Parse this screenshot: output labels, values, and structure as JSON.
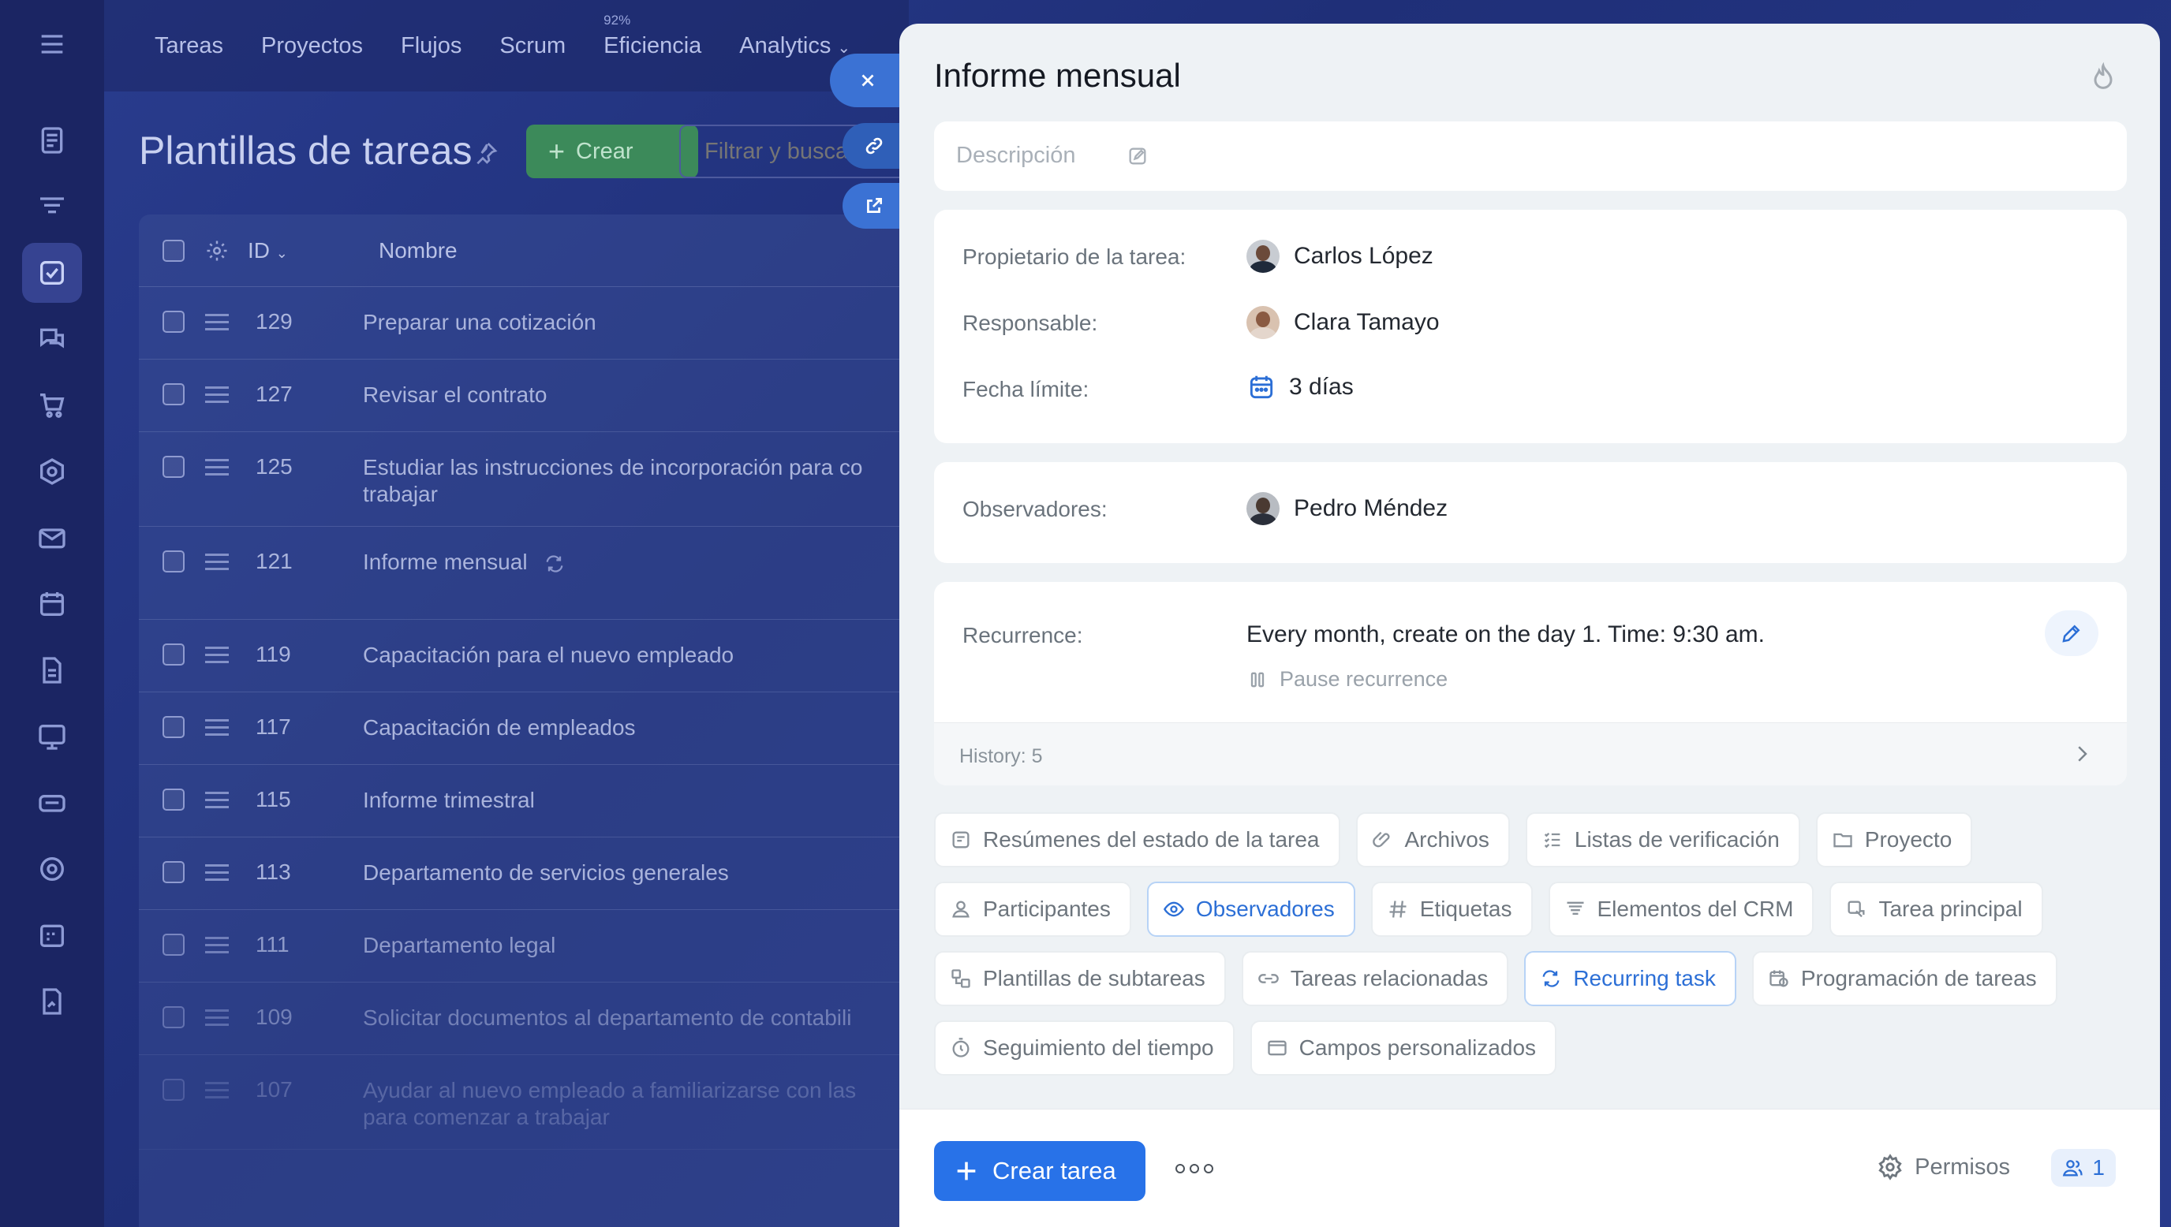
{
  "topnav": {
    "items": [
      "Tareas",
      "Proyectos",
      "Flujos",
      "Scrum",
      "Eficiencia",
      "Analytics"
    ],
    "efficiency_badge": "92%"
  },
  "page": {
    "title": "Plantillas de tareas",
    "create_label": "Crear",
    "filter_placeholder": "Filtrar y buscar"
  },
  "table": {
    "headers": {
      "id": "ID",
      "name": "Nombre"
    },
    "rows": [
      {
        "id": "129",
        "name": "Preparar una cotización"
      },
      {
        "id": "127",
        "name": "Revisar el contrato"
      },
      {
        "id": "125",
        "name": "Estudiar las instrucciones de incorporación para co",
        "name2": "trabajar"
      },
      {
        "id": "121",
        "name": "Informe mensual"
      },
      {
        "id": "119",
        "name": "Capacitación para el nuevo empleado"
      },
      {
        "id": "117",
        "name": "Capacitación de empleados"
      },
      {
        "id": "115",
        "name": "Informe trimestral"
      },
      {
        "id": "113",
        "name": "Departamento de servicios generales"
      },
      {
        "id": "111",
        "name": "Departamento legal"
      },
      {
        "id": "109",
        "name": "Solicitar documentos al departamento de contabili"
      },
      {
        "id": "107",
        "name": "Ayudar al nuevo empleado a familiarizarse con las",
        "name2": "para comenzar a trabajar"
      }
    ]
  },
  "panel": {
    "title": "Informe mensual",
    "description_placeholder": "Descripción",
    "owner_label": "Propietario de la tarea:",
    "owner": "Carlos López",
    "responsible_label": "Responsable:",
    "responsible": "Clara Tamayo",
    "deadline_label": "Fecha límite:",
    "deadline": "3 días",
    "observers_label": "Observadores:",
    "observer": "Pedro Méndez",
    "recurrence_label": "Recurrence:",
    "recurrence_value": "Every month, create on the day 1. Time: 9:30 am.",
    "pause_label": "Pause recurrence",
    "history": "History: 5",
    "chips": {
      "row1": [
        "Resúmenes del estado de la tarea",
        "Archivos",
        "Listas de verificación",
        "Proyecto"
      ],
      "row2": [
        "Participantes",
        "Observadores",
        "Etiquetas",
        "Elementos del CRM",
        "Tarea principal"
      ],
      "row3": [
        "Plantillas de subtareas",
        "Tareas relacionadas",
        "Recurring task",
        "Programación de tareas"
      ],
      "row4": [
        "Seguimiento del tiempo",
        "Campos personalizados"
      ]
    },
    "create_task_label": "Crear tarea",
    "permissions_label": "Permisos",
    "users_count": "1"
  },
  "colors": {
    "accent": "#2872e8",
    "selected_chip": "#2c6fd6",
    "create_green": "#3c8a5a"
  }
}
